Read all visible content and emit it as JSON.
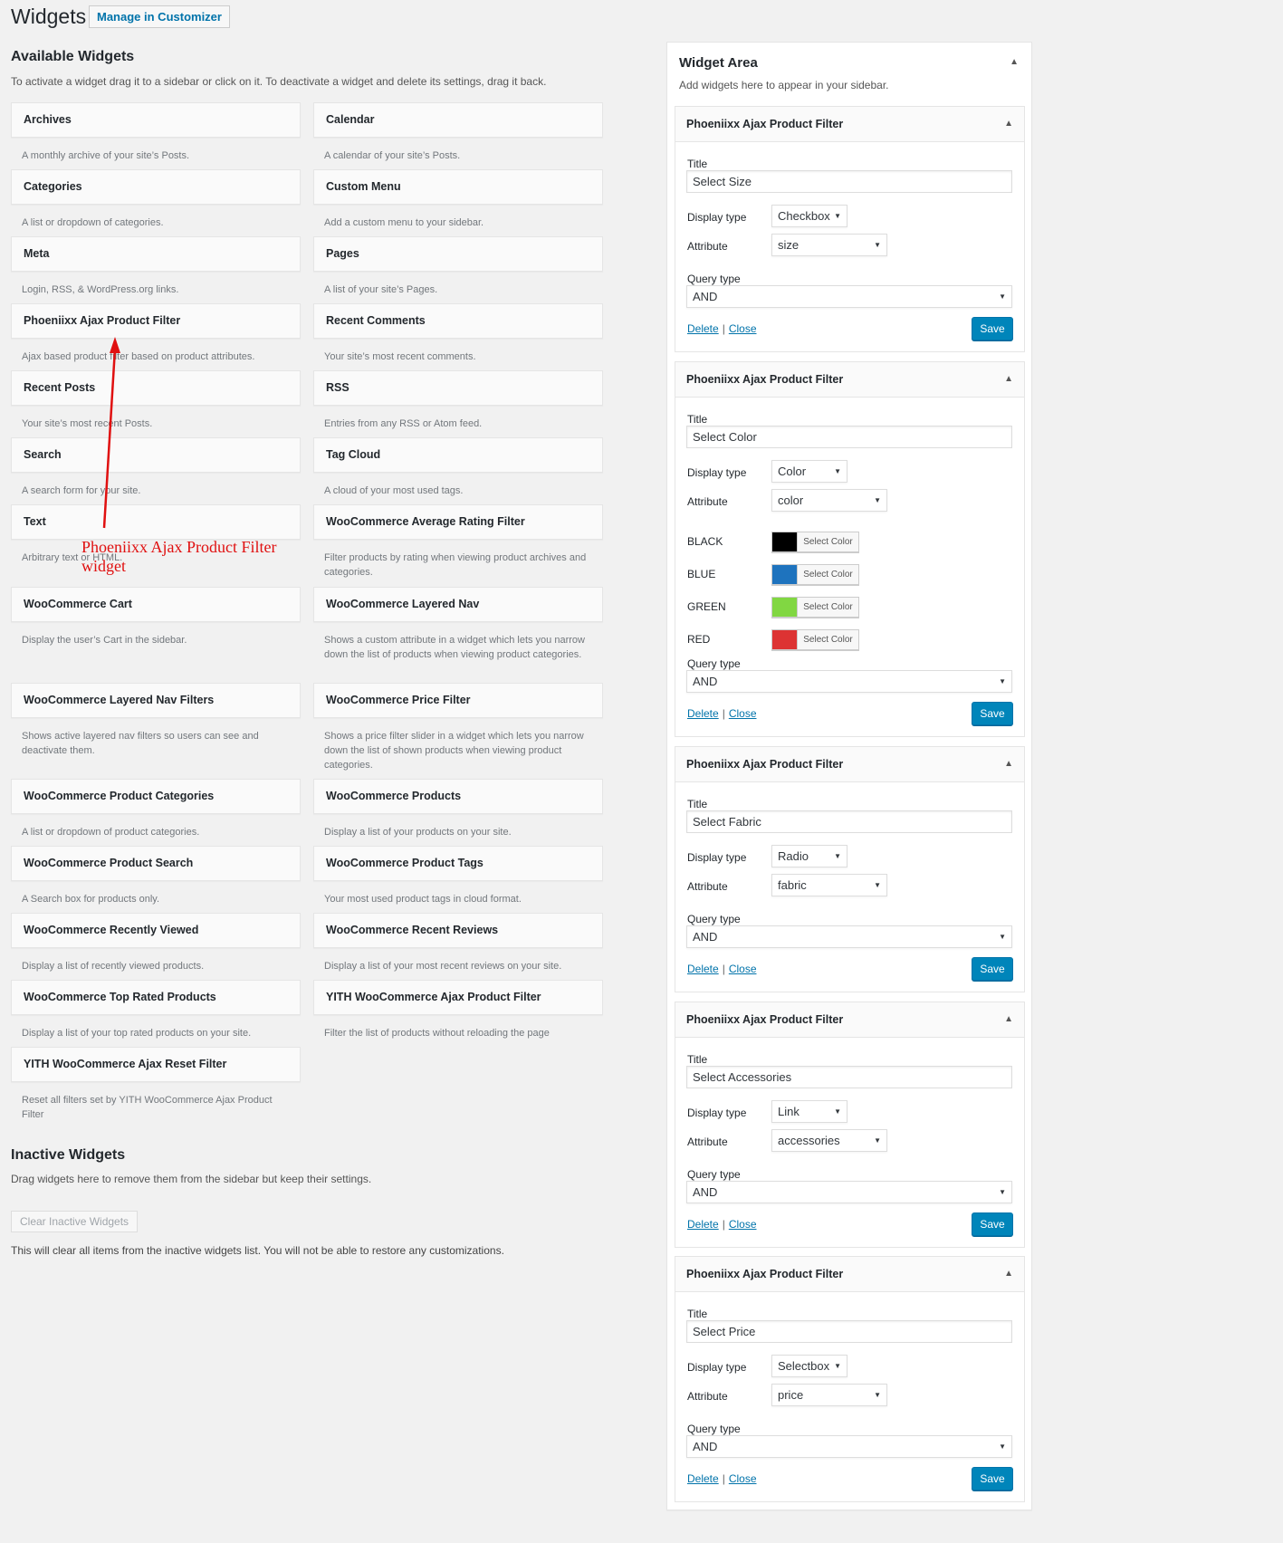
{
  "page": {
    "title": "Widgets",
    "manage_button": "Manage in Customizer"
  },
  "available": {
    "title": "Available Widgets",
    "description": "To activate a widget drag it to a sidebar or click on it. To deactivate a widget and delete its settings, drag it back."
  },
  "widgets_left": [
    {
      "name": "Archives",
      "desc": "A monthly archive of your site’s Posts."
    },
    {
      "name": "Categories",
      "desc": "A list or dropdown of categories."
    },
    {
      "name": "Meta",
      "desc": "Login, RSS, & WordPress.org links."
    },
    {
      "name": "Phoeniixx Ajax Product Filter",
      "desc": "Ajax based product filter based on product attributes."
    },
    {
      "name": "Recent Posts",
      "desc": "Your site’s most recent Posts."
    },
    {
      "name": "Search",
      "desc": "A search form for your site."
    },
    {
      "name": "Text",
      "desc": "Arbitrary text or HTML."
    },
    {
      "name": "WooCommerce Cart",
      "desc": "Display the user’s Cart in the sidebar."
    },
    {
      "name": "WooCommerce Layered Nav Filters",
      "desc": "Shows active layered nav filters so users can see and deactivate them."
    },
    {
      "name": "WooCommerce Product Categories",
      "desc": "A list or dropdown of product categories."
    },
    {
      "name": "WooCommerce Product Search",
      "desc": "A Search box for products only."
    },
    {
      "name": "WooCommerce Recently Viewed",
      "desc": "Display a list of recently viewed products."
    },
    {
      "name": "WooCommerce Top Rated Products",
      "desc": "Display a list of your top rated products on your site."
    },
    {
      "name": "YITH WooCommerce Ajax Reset Filter",
      "desc": "Reset all filters set by YITH WooCommerce Ajax Product Filter"
    }
  ],
  "widgets_right": [
    {
      "name": "Calendar",
      "desc": "A calendar of your site’s Posts."
    },
    {
      "name": "Custom Menu",
      "desc": "Add a custom menu to your sidebar."
    },
    {
      "name": "Pages",
      "desc": "A list of your site’s Pages."
    },
    {
      "name": "Recent Comments",
      "desc": "Your site’s most recent comments."
    },
    {
      "name": "RSS",
      "desc": "Entries from any RSS or Atom feed."
    },
    {
      "name": "Tag Cloud",
      "desc": "A cloud of your most used tags."
    },
    {
      "name": "WooCommerce Average Rating Filter",
      "desc": "Filter products by rating when viewing product archives and categories."
    },
    {
      "name": "WooCommerce Layered Nav",
      "desc": "Shows a custom attribute in a widget which lets you narrow down the list of products when viewing product categories."
    },
    {
      "name": "WooCommerce Price Filter",
      "desc": "Shows a price filter slider in a widget which lets you narrow down the list of shown products when viewing product categories."
    },
    {
      "name": "WooCommerce Products",
      "desc": "Display a list of your products on your site."
    },
    {
      "name": "WooCommerce Product Tags",
      "desc": "Your most used product tags in cloud format."
    },
    {
      "name": "WooCommerce Recent Reviews",
      "desc": "Display a list of your most recent reviews on your site."
    },
    {
      "name": "YITH WooCommerce Ajax Product Filter",
      "desc": "Filter the list of products without reloading the page"
    }
  ],
  "inactive": {
    "title": "Inactive Widgets",
    "description": "Drag widgets here to remove them from the sidebar but keep their settings.",
    "clear_button": "Clear Inactive Widgets",
    "clear_note": "This will clear all items from the inactive widgets list. You will not be able to restore any customizations."
  },
  "annotation": {
    "text_line1": "Phoeniixx Ajax Product Filter",
    "text_line2": "widget",
    "color": "#e01010"
  },
  "sidebar": {
    "name": "Widget Area",
    "description": "Add widgets here to appear in your sidebar.",
    "labels": {
      "title": "Title",
      "display_type": "Display type",
      "attribute": "Attribute",
      "query_type": "Query type",
      "delete": "Delete",
      "close": "Close",
      "save": "Save",
      "select_color": "Select Color"
    },
    "widgets": [
      {
        "name": "Phoeniixx Ajax Product Filter",
        "title_value": "Select Size",
        "display_type": "Checkbox",
        "attribute": "size",
        "query_type": "AND"
      },
      {
        "name": "Phoeniixx Ajax Product Filter",
        "title_value": "Select Color",
        "display_type": "Color",
        "attribute": "color",
        "query_type": "AND",
        "colors": [
          {
            "label": "BLACK",
            "hex": "#000000"
          },
          {
            "label": "BLUE",
            "hex": "#1e73be"
          },
          {
            "label": "GREEN",
            "hex": "#81d742"
          },
          {
            "label": "RED",
            "hex": "#dd3333"
          }
        ]
      },
      {
        "name": "Phoeniixx Ajax Product Filter",
        "title_value": "Select Fabric",
        "display_type": "Radio",
        "attribute": "fabric",
        "query_type": "AND"
      },
      {
        "name": "Phoeniixx Ajax Product Filter",
        "title_value": "Select Accessories",
        "display_type": "Link",
        "attribute": "accessories",
        "query_type": "AND"
      },
      {
        "name": "Phoeniixx Ajax Product Filter",
        "title_value": "Select Price",
        "display_type": "Selectbox",
        "attribute": "price",
        "query_type": "AND"
      }
    ]
  }
}
